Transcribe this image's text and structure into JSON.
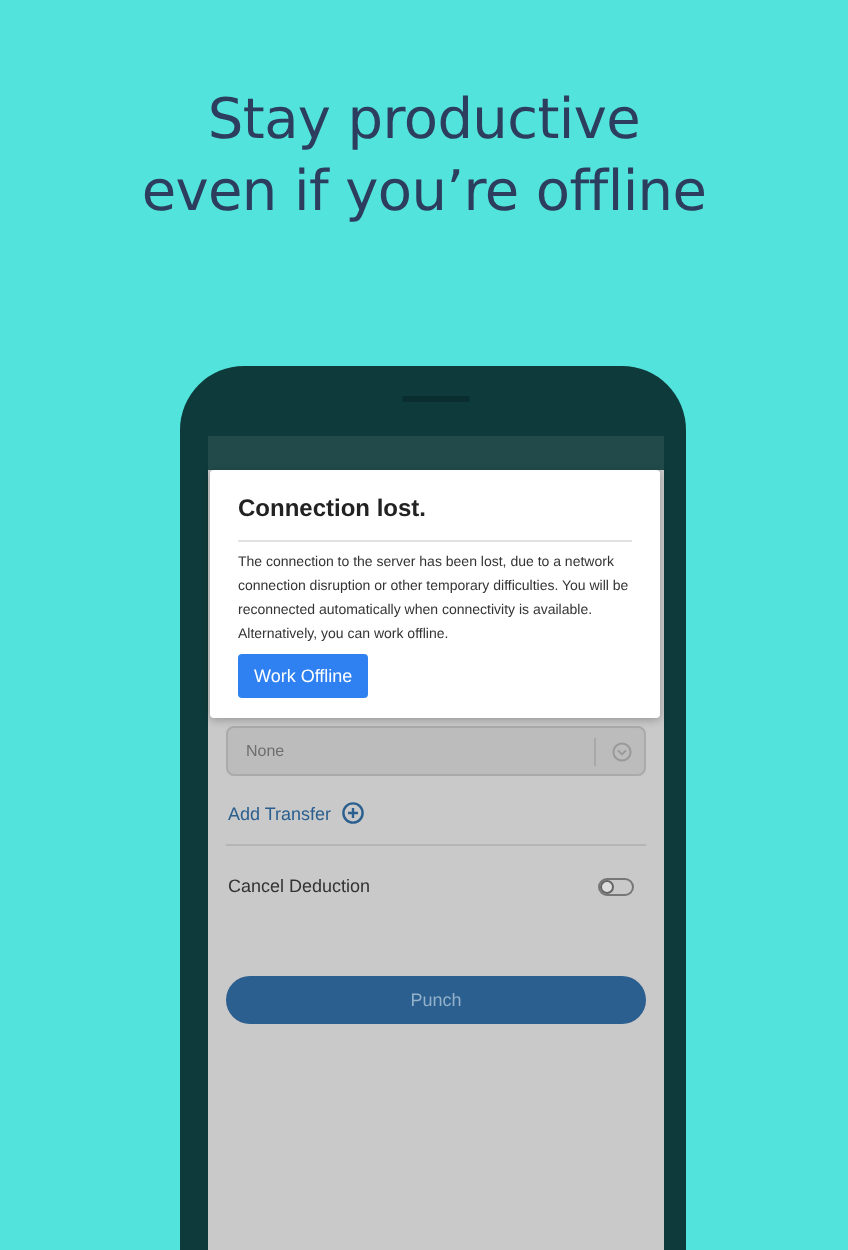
{
  "headline_lines": [
    "Stay productive",
    "even if you’re offline"
  ],
  "dialog": {
    "title": "Connection lost.",
    "paragraphs": [
      "The connection to the server has been lost, due to a network connection disruption or other temporary difficulties. You will be reconnected automatically when connectivity is available.",
      "Alternatively, you can work offline."
    ],
    "button": "Work Offline"
  },
  "form": {
    "field": {
      "placeholder": "None"
    },
    "add_link": "Add Transfer",
    "toggle": {
      "label": "Cancel Deduction",
      "on": false
    },
    "submit": "Punch"
  }
}
